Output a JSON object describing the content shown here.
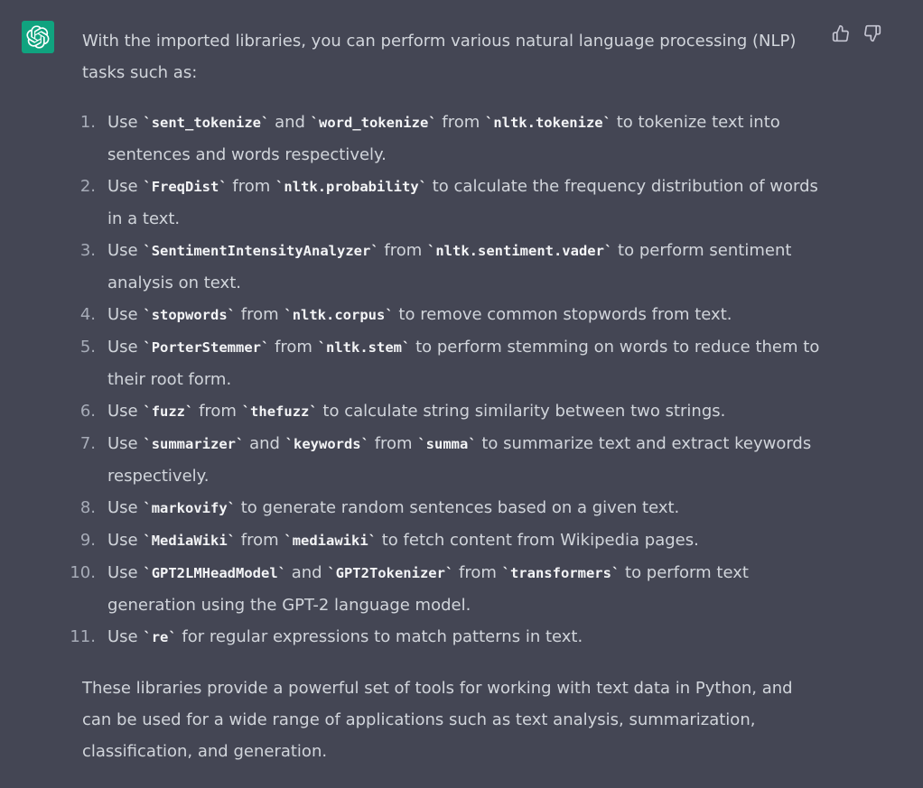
{
  "colors": {
    "background": "#444654",
    "avatar": "#10a37f",
    "text": "#d1d5db",
    "code_text": "#f3f4f6"
  },
  "avatar": {
    "icon": "openai-logo-icon"
  },
  "feedback": {
    "like_icon": "thumbs-up-icon",
    "dislike_icon": "thumbs-down-icon"
  },
  "message": {
    "intro": "With the imported libraries, you can perform various natural language processing (NLP) tasks such as:",
    "items": [
      {
        "num": "1.",
        "parts": [
          {
            "t": "Use "
          },
          {
            "c": "`sent_tokenize`"
          },
          {
            "t": " and "
          },
          {
            "c": "`word_tokenize`"
          },
          {
            "t": " from "
          },
          {
            "c": "`nltk.tokenize`"
          },
          {
            "t": " to tokenize text into sentences and words respectively."
          }
        ]
      },
      {
        "num": "2.",
        "parts": [
          {
            "t": "Use "
          },
          {
            "c": "`FreqDist`"
          },
          {
            "t": " from "
          },
          {
            "c": "`nltk.probability`"
          },
          {
            "t": " to calculate the frequency distribution of words in a text."
          }
        ]
      },
      {
        "num": "3.",
        "parts": [
          {
            "t": "Use "
          },
          {
            "c": "`SentimentIntensityAnalyzer`"
          },
          {
            "t": " from "
          },
          {
            "c": "`nltk.sentiment.vader`"
          },
          {
            "t": " to perform sentiment analysis on text."
          }
        ]
      },
      {
        "num": "4.",
        "parts": [
          {
            "t": "Use "
          },
          {
            "c": "`stopwords`"
          },
          {
            "t": " from "
          },
          {
            "c": "`nltk.corpus`"
          },
          {
            "t": " to remove common stopwords from text."
          }
        ]
      },
      {
        "num": "5.",
        "parts": [
          {
            "t": "Use "
          },
          {
            "c": "`PorterStemmer`"
          },
          {
            "t": " from "
          },
          {
            "c": "`nltk.stem`"
          },
          {
            "t": " to perform stemming on words to reduce them to their root form."
          }
        ]
      },
      {
        "num": "6.",
        "parts": [
          {
            "t": "Use "
          },
          {
            "c": "`fuzz`"
          },
          {
            "t": " from "
          },
          {
            "c": "`thefuzz`"
          },
          {
            "t": " to calculate string similarity between two strings."
          }
        ]
      },
      {
        "num": "7.",
        "parts": [
          {
            "t": "Use "
          },
          {
            "c": "`summarizer`"
          },
          {
            "t": " and "
          },
          {
            "c": "`keywords`"
          },
          {
            "t": " from "
          },
          {
            "c": "`summa`"
          },
          {
            "t": " to summarize text and extract keywords respectively."
          }
        ]
      },
      {
        "num": "8.",
        "parts": [
          {
            "t": "Use "
          },
          {
            "c": "`markovify`"
          },
          {
            "t": " to generate random sentences based on a given text."
          }
        ]
      },
      {
        "num": "9.",
        "parts": [
          {
            "t": "Use "
          },
          {
            "c": "`MediaWiki`"
          },
          {
            "t": " from "
          },
          {
            "c": "`mediawiki`"
          },
          {
            "t": " to fetch content from Wikipedia pages."
          }
        ]
      },
      {
        "num": "10.",
        "parts": [
          {
            "t": "Use "
          },
          {
            "c": "`GPT2LMHeadModel`"
          },
          {
            "t": " and "
          },
          {
            "c": "`GPT2Tokenizer`"
          },
          {
            "t": " from "
          },
          {
            "c": "`transformers`"
          },
          {
            "t": " to perform text generation using the GPT-2 language model."
          }
        ]
      },
      {
        "num": "11.",
        "parts": [
          {
            "t": "Use "
          },
          {
            "c": "`re`"
          },
          {
            "t": " for regular expressions to match patterns in text."
          }
        ]
      }
    ],
    "outro": "These libraries provide a powerful set of tools for working with text data in Python, and can be used for a wide range of applications such as text analysis, summarization, classification, and generation."
  }
}
